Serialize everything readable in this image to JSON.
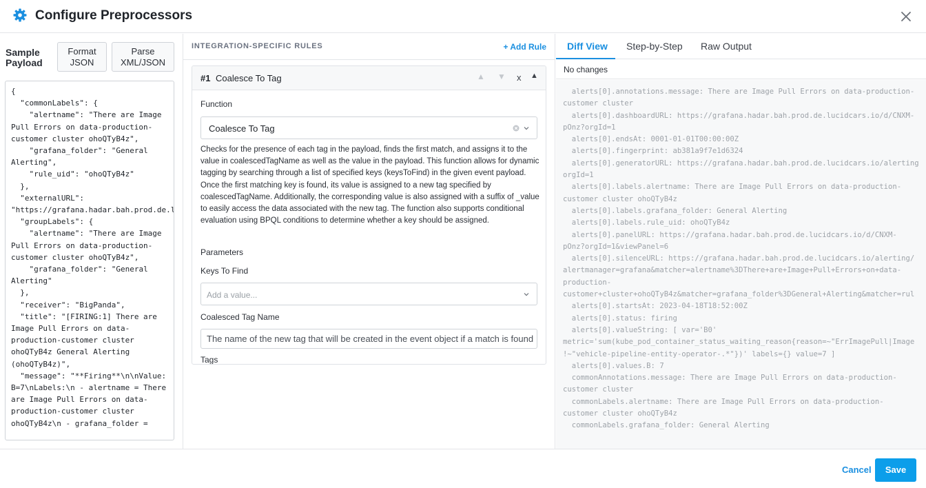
{
  "header": {
    "title": "Configure Preprocessors"
  },
  "sample_payload": {
    "label_line1": "Sample",
    "label_line2": "Payload",
    "format_json_line1": "Format",
    "format_json_line2": "JSON",
    "parse_xml_line1": "Parse",
    "parse_xml_line2": "XML/JSON",
    "content": "{\n  \"commonLabels\": {\n    \"alertname\": \"There are Image Pull Errors on data-production-customer cluster ohoQTyB4z\",\n    \"grafana_folder\": \"General Alerting\",\n    \"rule_uid\": \"ohoQTyB4z\"\n  },\n  \"externalURL\": \"https://grafana.hadar.bah.prod.de.lucidcars.io/\",\n  \"groupLabels\": {\n    \"alertname\": \"There are Image Pull Errors on data-production-customer cluster ohoQTyB4z\",\n    \"grafana_folder\": \"General Alerting\"\n  },\n  \"receiver\": \"BigPanda\",\n  \"title\": \"[FIRING:1] There are Image Pull Errors on data-production-customer cluster ohoQTyB4z General Alerting (ohoQTyB4z)\",\n  \"message\": \"**Firing**\\n\\nValue: B=7\\nLabels:\\n - alertname = There are Image Pull Errors on data-production-customer cluster ohoQTyB4z\\n - grafana_folder ="
  },
  "rules": {
    "section_title": "INTEGRATION-SPECIFIC RULES",
    "add_rule_label": "+ Add Rule",
    "rule": {
      "number": "#1",
      "name": "Coalesce To Tag",
      "move_up_icon": "▲",
      "move_down_icon": "▼",
      "remove_icon": "x",
      "collapse_icon": "▲",
      "function_label": "Function",
      "function_value": "Coalesce To Tag",
      "description": "Checks for the presence of each tag in the payload, finds the first match, and assigns it to the value in coalescedTagName as well as the value in the payload. This function allows for dynamic tagging by searching through a list of specified keys (keysToFind) in the given event payload. Once the first matching key is found, its value is assigned to a new tag specified by coalescedTagName. Additionally, the corresponding value is also assigned with a suffix of _value to easily access the data associated with the new tag. The function also supports conditional evaluation using BPQL conditions to determine whether a key should be assigned.",
      "parameters_label": "Parameters",
      "keys_to_find_label": "Keys To Find",
      "keys_to_find_placeholder": "Add a value...",
      "coalesced_tag_name_label": "Coalesced Tag Name",
      "coalesced_tag_name_value": "The name of the new tag that will be created in the event object if a match is found",
      "tags_label": "Tags"
    }
  },
  "output": {
    "tabs": [
      {
        "label": "Diff View",
        "active": true
      },
      {
        "label": "Step-by-Step",
        "active": false
      },
      {
        "label": "Raw Output",
        "active": false
      }
    ],
    "status": "No changes",
    "diff_content": "  alerts[0].annotations.message: There are Image Pull Errors on data-production-\ncustomer cluster\n  alerts[0].dashboardURL: https://grafana.hadar.bah.prod.de.lucidcars.io/d/CNXM-\npOnz?orgId=1\n  alerts[0].endsAt: 0001-01-01T00:00:00Z\n  alerts[0].fingerprint: ab381a9f7e1d6324\n  alerts[0].generatorURL: https://grafana.hadar.bah.prod.de.lucidcars.io/alerting\norgId=1\n  alerts[0].labels.alertname: There are Image Pull Errors on data-production-\ncustomer cluster ohoQTyB4z\n  alerts[0].labels.grafana_folder: General Alerting\n  alerts[0].labels.rule_uid: ohoQTyB4z\n  alerts[0].panelURL: https://grafana.hadar.bah.prod.de.lucidcars.io/d/CNXM-\npOnz?orgId=1&viewPanel=6\n  alerts[0].silenceURL: https://grafana.hadar.bah.prod.de.lucidcars.io/alerting/\nalertmanager=grafana&matcher=alertname%3DThere+are+Image+Pull+Errors+on+data-\nproduction-\ncustomer+cluster+ohoQTyB4z&matcher=grafana_folder%3DGeneral+Alerting&matcher=rul\n  alerts[0].startsAt: 2023-04-18T18:52:00Z\n  alerts[0].status: firing\n  alerts[0].valueString: [ var='B0'\nmetric='sum(kube_pod_container_status_waiting_reason{reason=~\"ErrImagePull|Image\n!~\"vehicle-pipeline-entity-operator-.*\"})' labels={} value=7 ]\n  alerts[0].values.B: 7\n  commonAnnotations.message: There are Image Pull Errors on data-production-\ncustomer cluster\n  commonLabels.alertname: There are Image Pull Errors on data-production-\ncustomer cluster ohoQTyB4z\n  commonLabels.grafana_folder: General Alerting"
  },
  "footer": {
    "cancel_label": "Cancel",
    "save_label": "Save"
  },
  "colors": {
    "accent": "#1a8fe0",
    "save_button": "#0c9eea"
  }
}
